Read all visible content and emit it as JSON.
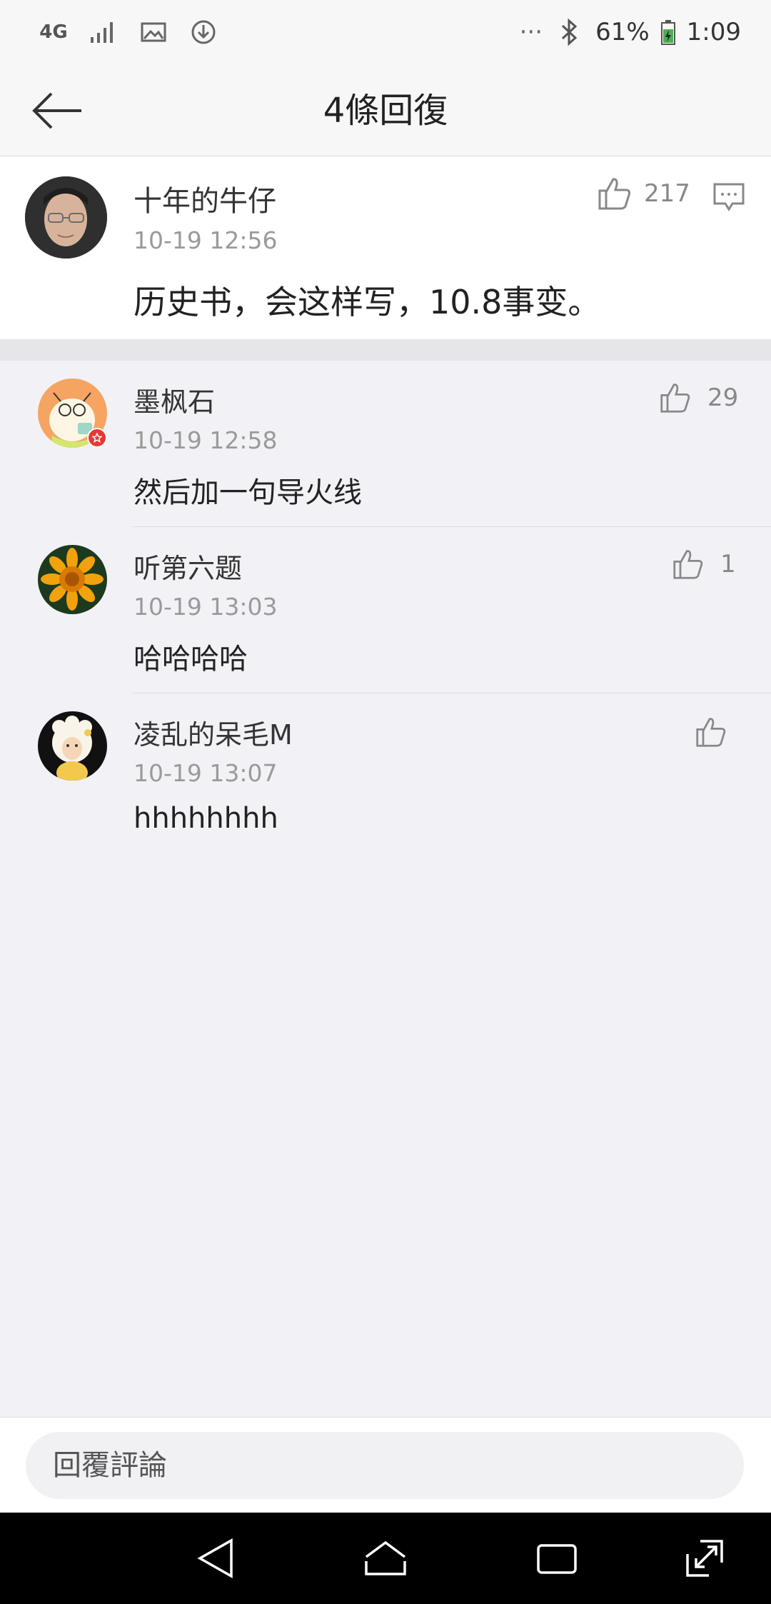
{
  "status_bar": {
    "network": "4G",
    "icons_left": [
      "network-4g-icon",
      "signal-icon",
      "image-icon",
      "download-icon"
    ],
    "more": "···",
    "battery_percent": "61%",
    "time": "1:09",
    "icons_right": [
      "more-icon",
      "bluetooth-icon",
      "battery-charging-icon"
    ]
  },
  "header": {
    "title": "4條回復",
    "back_icon": "back-arrow-icon"
  },
  "main_comment": {
    "username": "十年的牛仔",
    "timestamp": "10-19 12:56",
    "text": "历史书，会这样写，10.8事变。",
    "likes": "217",
    "like_icon": "thumbs-up-icon",
    "reply_icon": "comment-icon"
  },
  "replies": [
    {
      "username": "墨枫石",
      "timestamp": "10-19 12:58",
      "text": "然后加一句导火线",
      "likes": "29"
    },
    {
      "username": "听第六题",
      "timestamp": "10-19 13:03",
      "text": "哈哈哈哈",
      "likes": "1"
    },
    {
      "username": "凌乱的呆毛M",
      "timestamp": "10-19 13:07",
      "text": "hhhhhhhh",
      "likes": ""
    }
  ],
  "input": {
    "placeholder": "回覆評論"
  },
  "nav": {
    "icons": [
      "nav-back-icon",
      "nav-home-icon",
      "nav-recents-icon",
      "nav-expand-icon"
    ]
  },
  "colors": {
    "page_bg": "#f2f2f6",
    "card_bg": "#ffffff",
    "muted_text": "#9a9a9a",
    "accent_badge": "#e53935"
  }
}
